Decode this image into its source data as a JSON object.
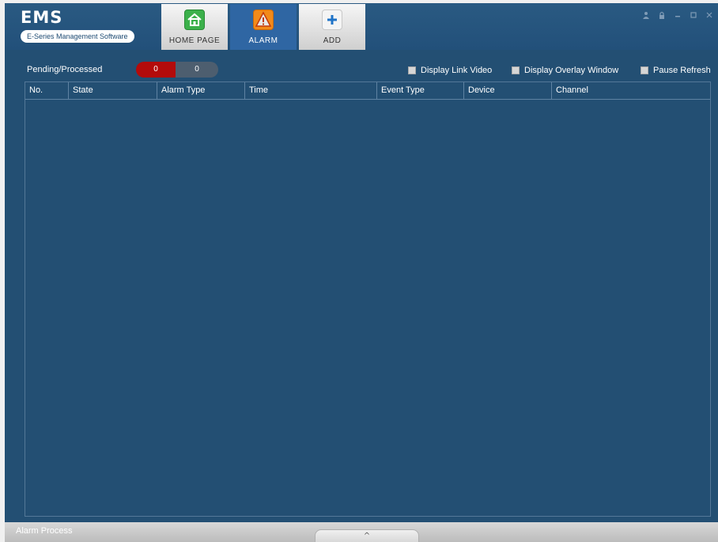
{
  "app": {
    "name": "EMS",
    "subtitle": "E-Series Management Software"
  },
  "tabs": [
    {
      "label": "HOME PAGE",
      "icon": "home-icon",
      "active": false
    },
    {
      "label": "ALARM",
      "icon": "warning-icon",
      "active": true
    },
    {
      "label": "ADD",
      "icon": "plus-icon",
      "active": false
    }
  ],
  "window_controls": [
    "user-icon",
    "lock-icon",
    "minimize-icon",
    "maximize-icon",
    "close-icon"
  ],
  "toolbar": {
    "pending_label": "Pending/Processed",
    "pending_count": "0",
    "processed_count": "0",
    "options": [
      {
        "label": "Display Link Video",
        "checked": false
      },
      {
        "label": "Display Overlay Window",
        "checked": false
      },
      {
        "label": "Pause Refresh",
        "checked": false
      }
    ]
  },
  "table": {
    "columns": [
      "No.",
      "State",
      "Alarm Type",
      "Time",
      "Event Type",
      "Device",
      "Channel"
    ],
    "rows": []
  },
  "bottom": {
    "label": "Alarm Process",
    "expander_glyph": "^"
  },
  "colors": {
    "background": "#234f73",
    "active_tab": "#2f66a3",
    "pending_badge": "#b30b0b",
    "processed_badge": "#4d5e6f"
  }
}
